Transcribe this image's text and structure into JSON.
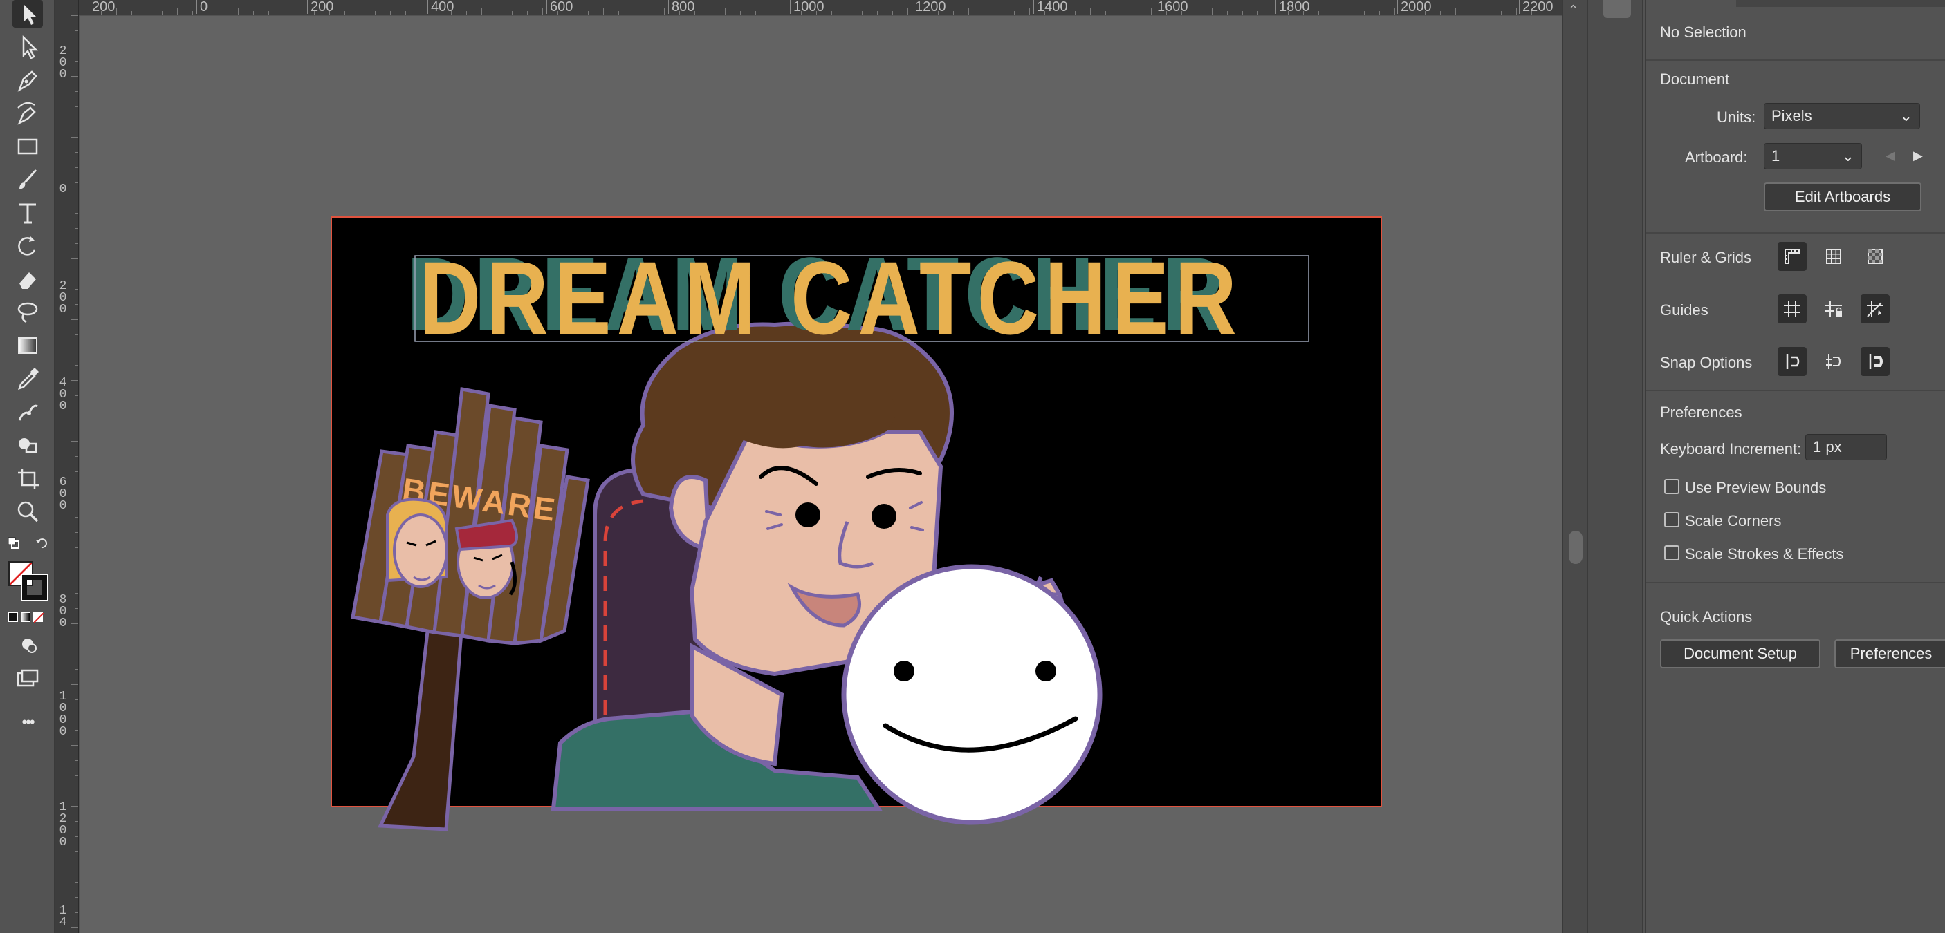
{
  "toolbar": {
    "tools": [
      {
        "name": "selection-tool",
        "icon": "arrow-icon"
      },
      {
        "name": "direct-selection-tool",
        "icon": "hollow-arrow-icon"
      },
      {
        "name": "pen-tool",
        "icon": "pen-icon"
      },
      {
        "name": "curvature-tool",
        "icon": "curvature-icon"
      },
      {
        "name": "rectangle-tool",
        "icon": "rectangle-icon"
      },
      {
        "name": "paintbrush-tool",
        "icon": "brush-icon"
      },
      {
        "name": "type-tool",
        "icon": "type-icon"
      },
      {
        "name": "rotate-tool",
        "icon": "rotate-icon"
      },
      {
        "name": "eraser-tool",
        "icon": "eraser-icon"
      },
      {
        "name": "lasso-tool",
        "icon": "lasso-icon"
      },
      {
        "name": "gradient-tool",
        "icon": "gradient-icon"
      },
      {
        "name": "eyedropper-tool",
        "icon": "eyedropper-icon"
      },
      {
        "name": "puppet-warp-tool",
        "icon": "puppet-icon"
      },
      {
        "name": "shape-builder-tool",
        "icon": "shape-builder-icon"
      },
      {
        "name": "artboard-tool",
        "icon": "artboard-icon"
      },
      {
        "name": "zoom-tool",
        "icon": "zoom-icon"
      }
    ],
    "more_label": "•••"
  },
  "ruler": {
    "horizontal": [
      "200",
      "0",
      "200",
      "400",
      "600",
      "800",
      "1000",
      "1200",
      "1400",
      "1600",
      "1800",
      "2000",
      "2200"
    ],
    "vertical": [
      "2\n0\n0",
      "0",
      "2\n0\n0",
      "4\n0\n0",
      "6\n0\n0",
      "8\n0\n0",
      "1\n0\n0\n0",
      "1\n2\n0\n0",
      "1\n4"
    ]
  },
  "artwork": {
    "title": "DREAM CATCHER",
    "sign_text": "BEWARE",
    "colors": {
      "background": "#000000",
      "title_yellow": "#e8b150",
      "title_shadow": "#347066",
      "outline": "#7a64a6",
      "hair": "#5c3a1e",
      "skin": "#e9bea8",
      "shirt": "#347066",
      "chair": "#3d2a40",
      "sign_wood": "#6b4a2a",
      "stick": "#3d2414",
      "sign_text": "#f1a45c",
      "artboard_border": "#e0533f"
    }
  },
  "panel": {
    "selection_label": "No Selection",
    "document": {
      "heading": "Document",
      "units_label": "Units:",
      "units_value": "Pixels",
      "artboard_label": "Artboard:",
      "artboard_value": "1",
      "edit_artboards": "Edit Artboards"
    },
    "ruler_grids": "Ruler & Grids",
    "guides": "Guides",
    "snap_options": "Snap Options",
    "preferences": {
      "heading": "Preferences",
      "keyboard_increment_label": "Keyboard Increment:",
      "keyboard_increment_value": "1 px",
      "checkboxes": [
        {
          "label": "Use Preview Bounds",
          "checked": false
        },
        {
          "label": "Scale Corners",
          "checked": false
        },
        {
          "label": "Scale Strokes & Effects",
          "checked": false
        }
      ]
    },
    "quick_actions": {
      "heading": "Quick Actions",
      "document_setup": "Document Setup",
      "preferences_button": "Preferences"
    }
  }
}
